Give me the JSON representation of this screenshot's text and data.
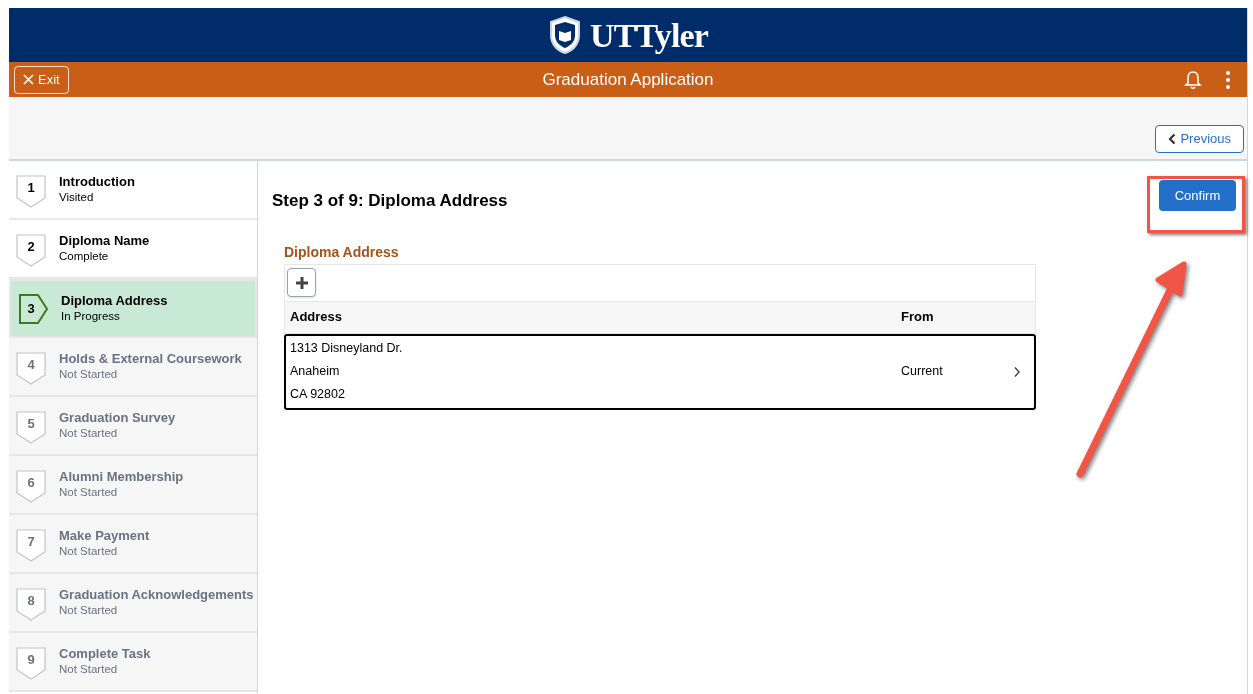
{
  "header": {
    "logo_text": "UTTyler"
  },
  "toolbar": {
    "exit_button": "Exit",
    "title": "Graduation Application"
  },
  "nav": {
    "previous_button": "Previous"
  },
  "steps": [
    {
      "number": "1",
      "label": "Introduction",
      "status": "Visited",
      "selected": false,
      "disabled": false
    },
    {
      "number": "2",
      "label": "Diploma Name",
      "status": "Complete",
      "selected": false,
      "disabled": false
    },
    {
      "number": "3",
      "label": "Diploma Address",
      "status": "In Progress",
      "selected": true,
      "disabled": false
    },
    {
      "number": "4",
      "label": "Holds & External Coursework",
      "status": "Not Started",
      "selected": false,
      "disabled": true
    },
    {
      "number": "5",
      "label": "Graduation Survey",
      "status": "Not Started",
      "selected": false,
      "disabled": true
    },
    {
      "number": "6",
      "label": "Alumni Membership",
      "status": "Not Started",
      "selected": false,
      "disabled": true
    },
    {
      "number": "7",
      "label": "Make Payment",
      "status": "Not Started",
      "selected": false,
      "disabled": true
    },
    {
      "number": "8",
      "label": "Graduation Acknowledgements",
      "status": "Not Started",
      "selected": false,
      "disabled": true
    },
    {
      "number": "9",
      "label": "Complete Task",
      "status": "Not Started",
      "selected": false,
      "disabled": true
    }
  ],
  "main": {
    "heading": "Step 3 of 9: Diploma Address",
    "confirm_button": "Confirm",
    "section_title": "Diploma Address",
    "table": {
      "columns": [
        "Address",
        "From"
      ],
      "rows": [
        {
          "address": [
            "1313 Disneyland Dr.",
            "Anaheim",
            "CA 92802"
          ],
          "from": "Current"
        }
      ]
    }
  }
}
